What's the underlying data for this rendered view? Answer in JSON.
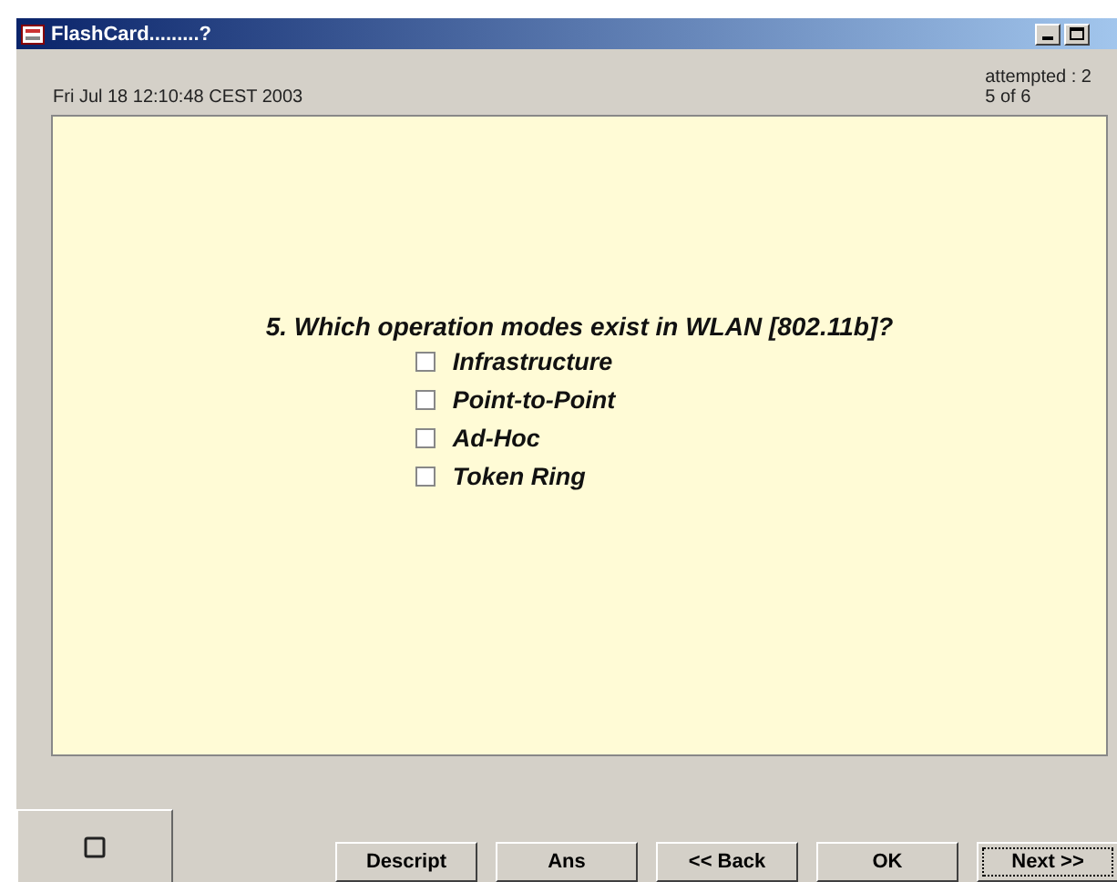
{
  "window": {
    "title": "FlashCard.........?"
  },
  "header": {
    "timestamp": "Fri Jul 18 12:10:48 CEST 2003",
    "attempted": "attempted : 2",
    "progress": "5 of 6"
  },
  "question": {
    "text": "5. Which operation modes exist in WLAN [802.11b]?",
    "options": [
      {
        "label": "Infrastructure",
        "checked": false
      },
      {
        "label": "Point-to-Point",
        "checked": false
      },
      {
        "label": "Ad-Hoc",
        "checked": false
      },
      {
        "label": "Token Ring",
        "checked": false
      }
    ]
  },
  "buttons": [
    {
      "label": "Descript",
      "focused": false
    },
    {
      "label": "Ans",
      "focused": false
    },
    {
      "label": "<< Back",
      "focused": false
    },
    {
      "label": "OK",
      "focused": false
    },
    {
      "label": "Next >>",
      "focused": true
    }
  ]
}
